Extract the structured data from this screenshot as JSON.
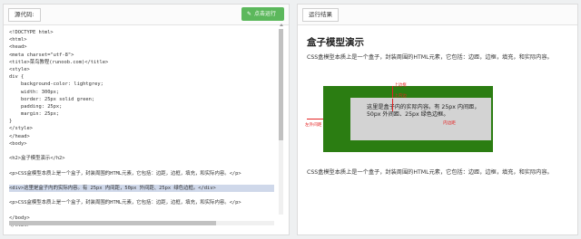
{
  "editor": {
    "source_tag": "源代码:",
    "run_button": "点击运行",
    "lines": [
      "<!DOCTYPE html>",
      "<html>",
      "<head>",
      "<meta charset=\"utf-8\">",
      "<title>菜鸟教程(runoob.com)</title>",
      "<style>",
      "div {",
      "    background-color: lightgrey;",
      "    width: 300px;",
      "    border: 25px solid green;",
      "    padding: 25px;",
      "    margin: 25px;",
      "}",
      "</style>",
      "</head>",
      "<body>",
      "",
      "<h2>盒子模型演示</h2>",
      "",
      "<p>CSS盒模型本质上是一个盒子，封装周围的HTML元素，它包括：边距，边框，填充，和实际内容。</p>",
      "",
      "<div>这里是盒子内的实际内容。有 25px 内间距，50px 外间距、25px 绿色边框。</div>",
      "",
      "<p>CSS盒模型本质上是一个盒子，封装周围的HTML元素，它包括：边距，边框，填充，和实际内容。</p>",
      "",
      "</body>",
      "</html>"
    ],
    "highlighted_line": 21
  },
  "result": {
    "tag": "运行结果",
    "title": "盒子模型演示",
    "paragraph": "CSS盒模型本质上是一个盒子，封装周围的HTML元素，它包括：边距，边框，填充，和实际内容。",
    "box_text": "这里是盒子内的实际内容。有 25px 内间距，50px 外间距、25px 绿色边框。",
    "annotations": {
      "top_margin": "上边框",
      "top_padding": "上内边",
      "right_border": "内边距",
      "left_margin": "左外间距"
    }
  },
  "colors": {
    "run_button": "#5cb85c",
    "border": "#2b7d12",
    "content_bg": "#d3d3d3",
    "annotation": "#e52222",
    "highlight": "#cfd8ea"
  }
}
